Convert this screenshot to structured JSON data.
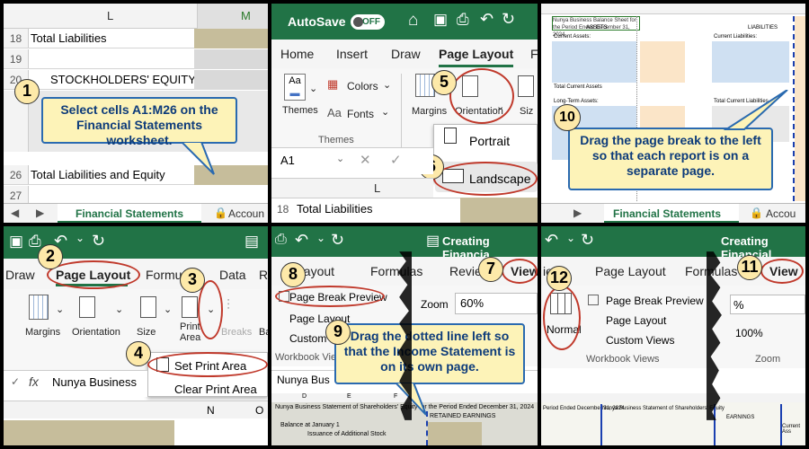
{
  "p1": {
    "col_L": "L",
    "col_M": "M",
    "rows": [
      {
        "n": "18",
        "text": "Total Liabilities"
      },
      {
        "n": "19",
        "text": ""
      },
      {
        "n": "20",
        "text": "STOCKHOLDERS' EQUITY"
      },
      {
        "n": "26",
        "text": "Total Liabilities and Equity"
      },
      {
        "n": "27",
        "text": ""
      }
    ],
    "step": "1",
    "callout": "Select cells A1:M26 on the Financial Statements worksheet.",
    "tab": "Financial Statements",
    "tab2": "Accoun"
  },
  "p2": {
    "autosave": "AutoSave",
    "toggle": "OFF",
    "tabs": [
      "Home",
      "Insert",
      "Draw",
      "Page Layout",
      "F"
    ],
    "themes": "Themes",
    "colors": "Colors",
    "fonts": "Fonts",
    "themes_group": "Themes",
    "margins": "Margins",
    "orientation": "Orientation",
    "size": "Siz",
    "portrait": "Portrait",
    "landscape": "Landscape",
    "namebox": "A1",
    "col": "L",
    "row_n": "18",
    "row_text": "Total Liabilities",
    "step5": "5",
    "step6": "6"
  },
  "p3": {
    "header": "Nunya Business Balance Sheet for the Period Ended December 31, 2024",
    "assets": "ASSETS",
    "liab": "LIABILITIES",
    "current_assets": "Current Assets:",
    "current_liab": "Current Liabilities:",
    "total_ca": "Total Current Assets",
    "lta": "Long-Term Assets:",
    "tcl": "Total Current Liabilities",
    "step": "10",
    "callout": "Drag the page break to the left so that each report is on a separate page.",
    "tab": "Financial Statements",
    "tab2": "Accou"
  },
  "p4": {
    "tabs": [
      "Draw",
      "Page Layout",
      "Formu",
      "Data",
      "Rev"
    ],
    "margins": "Margins",
    "orientation": "Orientation",
    "size": "Size",
    "print_area": "Print Area",
    "breaks": "Breaks",
    "ba": "Ba",
    "set_print_area": "Set Print Area",
    "clear_print_area": "Clear Print Area",
    "namebox_fx": "fx",
    "formula": "Nunya Business",
    "cols": [
      "N",
      "O"
    ],
    "step2": "2",
    "step3": "3",
    "step4": "4"
  },
  "p5": {
    "title": "Creating Financia",
    "tabs": [
      "Layout",
      "Formulas",
      "Revie",
      "View"
    ],
    "pbp": "Page Break Preview",
    "pl": "Page Layout",
    "custom": "Custom",
    "zoom": "Zoom",
    "zoom_val": "60%",
    "wbv": "Workbook View",
    "name_cell": "Nunya Bus",
    "sheet_cols": [
      "D",
      "E",
      "F"
    ],
    "sheet_r1": "Nunya Business Statement of Shareholders' Equity for the Period Ended December 31, 2024",
    "sheet_r2": "RETAINED EARNINGS",
    "sheet_r3": "Balance at January 1",
    "sheet_r4": "Issuance of Additional Stock",
    "step7": "7",
    "step8": "8",
    "step9": "9",
    "callout": "Drag the dotted line left so that the Income Statement is on its own page."
  },
  "p6": {
    "title": "Creating Financial",
    "tabs": [
      "iew",
      "Page Layout",
      "Formulas",
      "View"
    ],
    "normal": "Normal",
    "pbp": "Page Break Preview",
    "pl": "Page Layout",
    "cv": "Custom Views",
    "wbv": "Workbook Views",
    "zoom": "Zoom",
    "zoom_val": "%",
    "pct100": "100%",
    "sheet_r1": "Period Ended December 31, 2024",
    "sheet_r1b": "Nunya Business Statement of Shareholders' Equity",
    "sheet_r2": "EARNINGS",
    "sheet_r3": "Current Ass",
    "step11": "11",
    "step12": "12"
  }
}
